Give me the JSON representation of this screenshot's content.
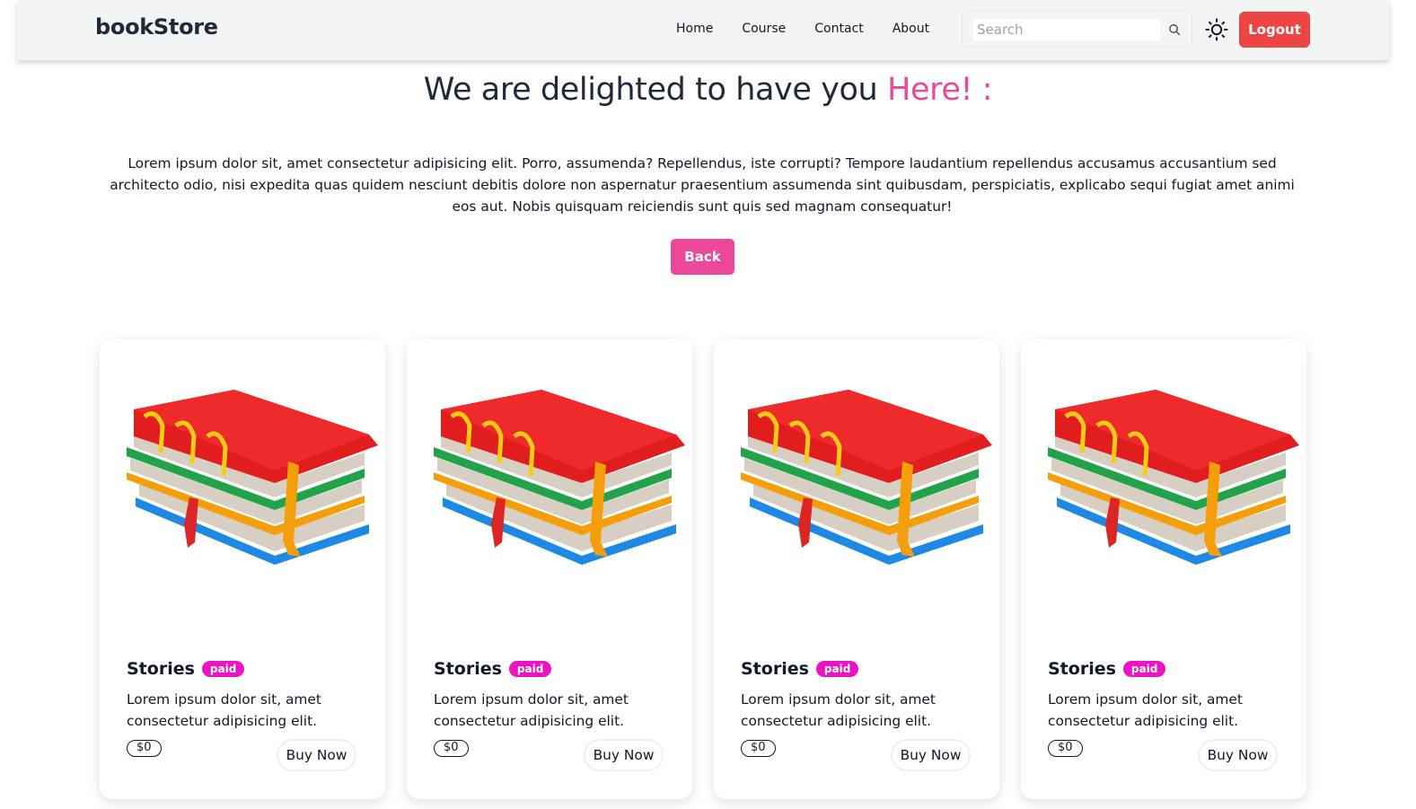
{
  "header": {
    "brand": "bookStore",
    "nav": [
      "Home",
      "Course",
      "Contact",
      "About"
    ],
    "search_placeholder": "Search",
    "theme_icon": "sun-icon",
    "search_icon": "search-icon",
    "logout_label": "Logout"
  },
  "hero": {
    "title_main": "We are delighted to have you ",
    "title_accent": "Here! :",
    "body": "Lorem ipsum dolor sit, amet consectetur adipisicing elit. Porro, assumenda? Repellendus, iste corrupti? Tempore laudantium repellendus accusamus accusantium sed architecto odio, nisi expedita quas quidem nesciunt debitis dolore non aspernatur praesentium assumenda sint quibusdam, perspiciatis, explicabo sequi fugiat amet animi eos aut. Nobis quisquam reiciendis sunt quis sed magnam consequatur!",
    "back_label": "Back"
  },
  "cards": [
    {
      "name": "Stories",
      "badge": "paid",
      "description": "Lorem ipsum dolor sit, amet consectetur adipisicing elit.",
      "price": "$0",
      "buy_label": "Buy Now"
    },
    {
      "name": "Stories",
      "badge": "paid",
      "description": "Lorem ipsum dolor sit, amet consectetur adipisicing elit.",
      "price": "$0",
      "buy_label": "Buy Now"
    },
    {
      "name": "Stories",
      "badge": "paid",
      "description": "Lorem ipsum dolor sit, amet consectetur adipisicing elit.",
      "price": "$0",
      "buy_label": "Buy Now"
    },
    {
      "name": "Stories",
      "badge": "paid",
      "description": "Lorem ipsum dolor sit, amet consectetur adipisicing elit.",
      "price": "$0",
      "buy_label": "Buy Now"
    }
  ],
  "colors": {
    "accent": "#ec4899",
    "badge": "#ec13c4",
    "logout": "#ef4444",
    "navbar_bg": "#f3f4f6"
  }
}
